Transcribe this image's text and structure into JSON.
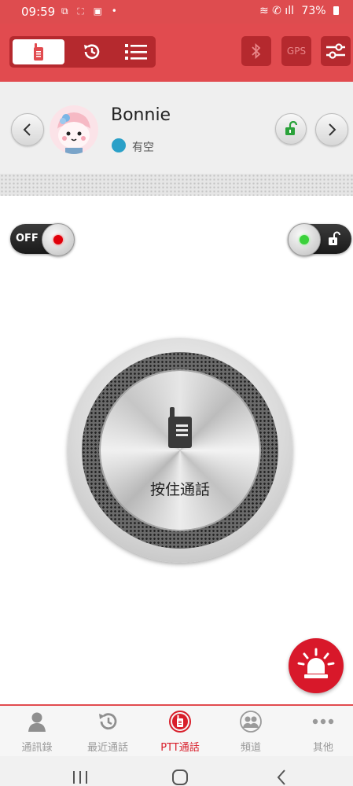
{
  "status_bar": {
    "time": "09:59",
    "notification_icons": "⧉ ⛶ ▣ •",
    "signal_icons": "≋ ✆ ıll",
    "battery": "73%"
  },
  "toolbar": {
    "tabs": [
      {
        "name": "ptt-tab",
        "icon": "walkie-talkie-icon",
        "active": true
      },
      {
        "name": "history-tab",
        "icon": "history-icon",
        "active": false
      },
      {
        "name": "list-tab",
        "icon": "list-icon",
        "active": false
      }
    ],
    "bluetooth_icon": "bluetooth-icon",
    "gps_label": "GPS",
    "settings_icon": "sliders-icon"
  },
  "contact": {
    "name": "Bonnie",
    "status": "有空",
    "status_color": "#2aa0c8"
  },
  "toggles": {
    "left_label": "OFF",
    "left_indicator_color": "#e0000a",
    "right_indicator_color": "#3ad13a"
  },
  "ptt_button": {
    "label": "按住通話"
  },
  "bottom_nav": {
    "items": [
      {
        "label": "通訊錄",
        "icon": "contacts-icon"
      },
      {
        "label": "最近通話",
        "icon": "recent-calls-icon"
      },
      {
        "label": "PTT通話",
        "icon": "ptt-icon"
      },
      {
        "label": "頻道",
        "icon": "channel-icon"
      },
      {
        "label": "其他",
        "icon": "more-icon"
      }
    ],
    "active_index": 2
  },
  "colors": {
    "accent": "#e14b4f",
    "accent_dark": "#b5292e",
    "alarm": "#d8182a"
  }
}
